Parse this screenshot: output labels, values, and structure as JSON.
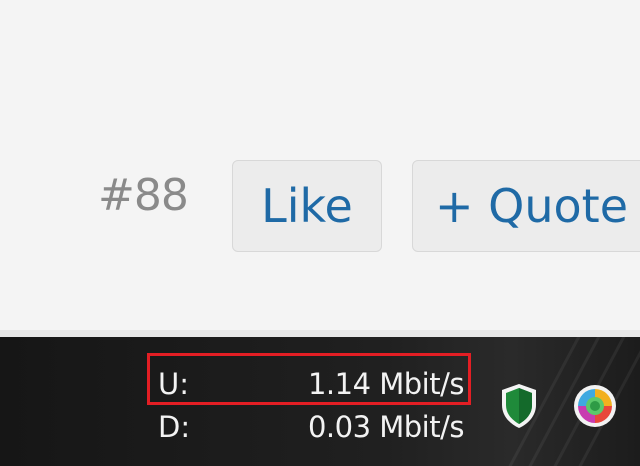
{
  "post": {
    "number": "#88",
    "like_label": "Like",
    "quote_label": "+ Quote"
  },
  "taskbar": {
    "upload_label": "U:",
    "upload_value": "1.14 Mbit/s",
    "download_label": "D:",
    "download_value": "0.03 Mbit/s",
    "tray_icons": [
      "shield-icon",
      "browser-icon"
    ],
    "highlight_color": "#e31e24"
  },
  "colors": {
    "button_text": "#1f6aa6",
    "post_number": "#8a8a8a",
    "taskbar_bg": "#1b1b1b"
  }
}
